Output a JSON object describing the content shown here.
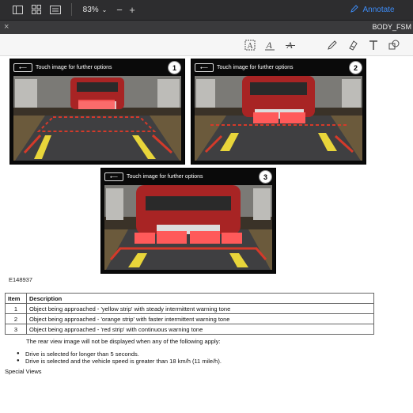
{
  "app": {
    "zoom": "83%",
    "annotate_label": "Annotate",
    "tab_title": "BODY_FSM",
    "accent": "#3d8bf5"
  },
  "figures": [
    {
      "header": "Touch image for further options",
      "number": "1",
      "warning": "yellow"
    },
    {
      "header": "Touch image for further options",
      "number": "2",
      "warning": "orange"
    },
    {
      "header": "Touch image for further options",
      "number": "3",
      "warning": "red"
    }
  ],
  "figure_id": "E148937",
  "table": {
    "headers": [
      "Item",
      "Description"
    ],
    "rows": [
      {
        "item": "1",
        "description": "Object being approached - 'yellow strip' with steady intermittent warning tone"
      },
      {
        "item": "2",
        "description": "Object being approached - 'orange strip' with faster intermittent warning tone"
      },
      {
        "item": "3",
        "description": "Object being approached - 'red strip' with continuous warning tone"
      }
    ]
  },
  "note": "The rear view image will not be displayed when any of the following apply:",
  "bullets": [
    "Drive is selected for longer than 5 seconds.",
    "Drive is selected and the vehicle speed is greater than 18 km/h (11 mile/h)."
  ],
  "section_heading": "Special Views"
}
